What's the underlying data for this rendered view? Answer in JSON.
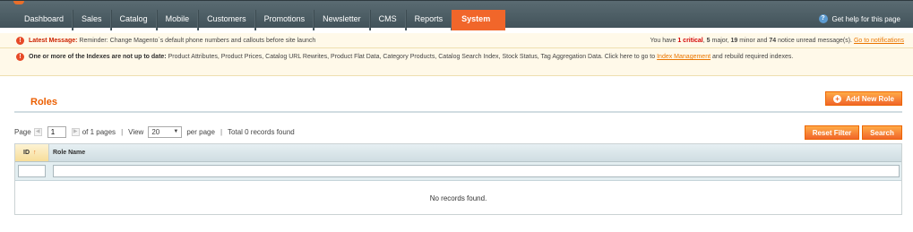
{
  "nav": {
    "items": [
      "Dashboard",
      "Sales",
      "Catalog",
      "Mobile",
      "Customers",
      "Promotions",
      "Newsletter",
      "CMS",
      "Reports",
      "System"
    ],
    "active": "System",
    "help_icon": "question-circle-icon",
    "help_label": "Get help for this page"
  },
  "notifications": {
    "latest": {
      "label": "Latest Message:",
      "text": "Reminder: Change Magento`s default phone numbers and callouts before site launch",
      "summary_prefix": "You have",
      "critical": "1 critical",
      "major": "5",
      "major_suffix": "major,",
      "minor": "19",
      "minor_suffix": "minor and",
      "notice": "74",
      "notice_suffix": "notice unread message(s).",
      "link": "Go to notifications"
    },
    "index": {
      "label": "One or more of the Indexes are not up to date:",
      "text": "Product Attributes, Product Prices, Catalog URL Rewrites, Product Flat Data, Category Products, Catalog Search Index, Stock Status, Tag Aggregation Data. Click here to go to",
      "link": "Index Management",
      "tail": "and rebuild required indexes."
    }
  },
  "page": {
    "title": "Roles",
    "add_button": "Add New Role"
  },
  "pager": {
    "page_label": "Page",
    "page_value": "1",
    "of_pages": "of 1 pages",
    "view_label": "View",
    "view_value": "20",
    "per_page": "per page",
    "total": "Total 0 records found",
    "reset_filter": "Reset Filter",
    "search": "Search"
  },
  "grid": {
    "columns": [
      "ID",
      "Role Name"
    ],
    "sort_indicator": "↑",
    "empty_text": "No records found."
  },
  "colors": {
    "accent": "#f1662a",
    "nav_bg": "#4e5f66",
    "notice_bg": "#fff9e9"
  }
}
